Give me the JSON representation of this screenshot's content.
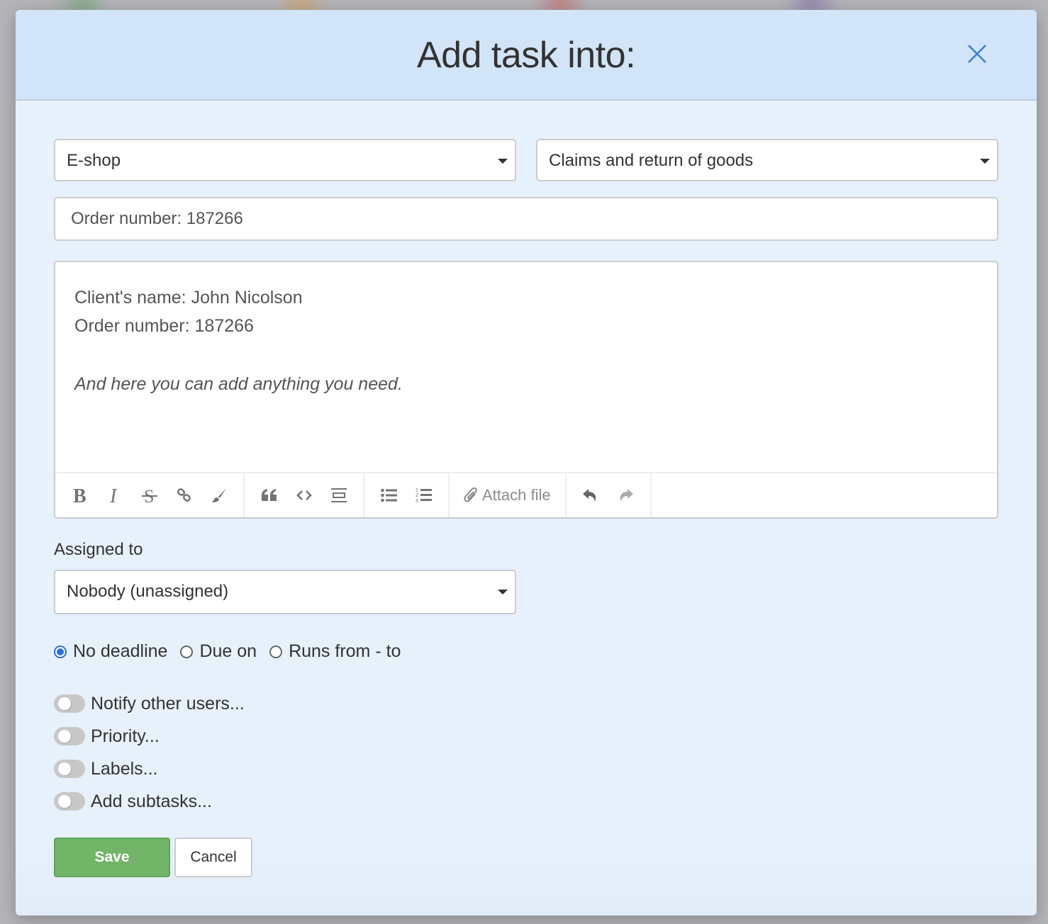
{
  "modal": {
    "title": "Add task into:",
    "close_icon": "close-icon"
  },
  "project_select": {
    "value": "E-shop"
  },
  "list_select": {
    "value": "Claims and return of goods"
  },
  "task_title_input": {
    "value": "Order number: 187266"
  },
  "description": {
    "lines": [
      "Client's name: John Nicolson",
      "Order number: 187266"
    ],
    "italic_line": "And here you can add anything you need."
  },
  "toolbar": {
    "groups": [
      [
        "bold-icon",
        "italic-icon",
        "strikethrough-icon",
        "link-icon",
        "paintbrush-icon"
      ],
      [
        "quote-icon",
        "code-icon",
        "horizontal-rule-icon"
      ],
      [
        "bullet-list-icon",
        "numbered-list-icon"
      ],
      [
        "paperclip-icon"
      ],
      [
        "undo-icon",
        "redo-icon"
      ]
    ],
    "attach_label": "Attach file"
  },
  "assigned": {
    "label": "Assigned to",
    "value": "Nobody (unassigned)"
  },
  "deadline": {
    "options": [
      "No deadline",
      "Due on",
      "Runs from - to"
    ],
    "selected": "No deadline"
  },
  "options_toggles": [
    {
      "label": "Notify other users...",
      "on": false
    },
    {
      "label": "Priority...",
      "on": false
    },
    {
      "label": "Labels...",
      "on": false
    },
    {
      "label": "Add subtasks...",
      "on": false
    }
  ],
  "buttons": {
    "save": "Save",
    "cancel": "Cancel"
  },
  "colors": {
    "header_bg": "#d2e4f8",
    "body_bg": "#e6f1fc",
    "accent_blue": "#2e6fdc",
    "save_green": "#72b568"
  }
}
